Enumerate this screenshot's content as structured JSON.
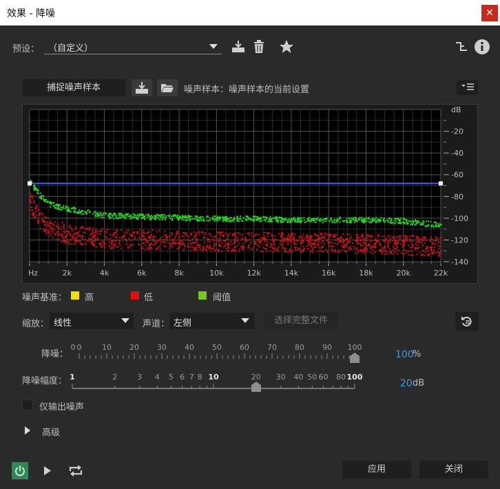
{
  "window": {
    "title": "效果 - 降噪",
    "close_glyph": "✕"
  },
  "preset": {
    "label": "预设：",
    "value": "（自定义）"
  },
  "capture": {
    "button_label": "捕捉噪声样本",
    "status_text": "噪声样本：噪声样本的当前设置"
  },
  "graph": {
    "y_unit": "dB",
    "y_ticks": [
      "-20",
      "-40",
      "-60",
      "-80",
      "-100",
      "-120",
      "-140"
    ],
    "x_ticks": [
      "Hz",
      "2k",
      "4k",
      "6k",
      "8k",
      "10k",
      "12k",
      "14k",
      "16k",
      "18k",
      "20k",
      "22k"
    ],
    "threshold_db": -68
  },
  "chart_data": {
    "type": "scatter",
    "x_unit": "Hz",
    "xlim": [
      0,
      22000
    ],
    "y_unit": "dB",
    "ylim": [
      -140,
      0
    ],
    "series": [
      {
        "name": "阈值",
        "color": "#22dd22",
        "x": [
          0,
          500,
          1000,
          1500,
          2000,
          3000,
          4000,
          6000,
          8000,
          10000,
          12000,
          14000,
          16000,
          18000,
          20000,
          21000,
          22000
        ],
        "values": [
          -66,
          -78,
          -86,
          -89,
          -91,
          -94,
          -97,
          -98,
          -99,
          -100,
          -100,
          -101,
          -101,
          -101,
          -102,
          -104,
          -106
        ]
      },
      {
        "name": "低",
        "color": "#dd1111",
        "x": [
          0,
          500,
          1000,
          2000,
          4000,
          6000,
          8000,
          10000,
          12000,
          14000,
          16000,
          18000,
          20000,
          22000
        ],
        "values": [
          -84,
          -100,
          -108,
          -114,
          -118,
          -119,
          -120,
          -121,
          -121,
          -122,
          -122,
          -123,
          -124,
          -126
        ]
      }
    ]
  },
  "legend": {
    "label": "噪声基准：",
    "items": [
      {
        "name": "高",
        "color": "#f0e000"
      },
      {
        "name": "低",
        "color": "#dd1111"
      },
      {
        "name": "阈值",
        "color": "#7ac81e"
      }
    ]
  },
  "scale": {
    "label": "缩放：",
    "value": "线性"
  },
  "channel": {
    "label": "声道：",
    "value": "左侧"
  },
  "select_file": {
    "label": "选择完整文件"
  },
  "noise_reduction": {
    "label": "降噪：",
    "value": "100",
    "unit": "%",
    "ticks": [
      "0",
      "0",
      "10",
      "20",
      "30",
      "40",
      "50",
      "60",
      "70",
      "80",
      "90",
      "100"
    ],
    "level": 1.0
  },
  "reduce_by": {
    "label": "降噪幅度：",
    "value": "20",
    "unit": "dB",
    "ticks": [
      "1",
      "2",
      "3",
      "4",
      "5",
      "6",
      "7",
      "8",
      "10",
      "20",
      "30",
      "40",
      "50",
      "60",
      "80",
      "100"
    ],
    "level_db": 20
  },
  "output_noise_only": {
    "label": "仅输出噪声",
    "checked": false
  },
  "advanced": {
    "label": "高级"
  },
  "footer": {
    "apply": "应用",
    "close": "关闭"
  },
  "colors": {
    "accent": "#3d9de0",
    "power_green": "#2e8b57",
    "threshold_line": "#4a5cff"
  }
}
